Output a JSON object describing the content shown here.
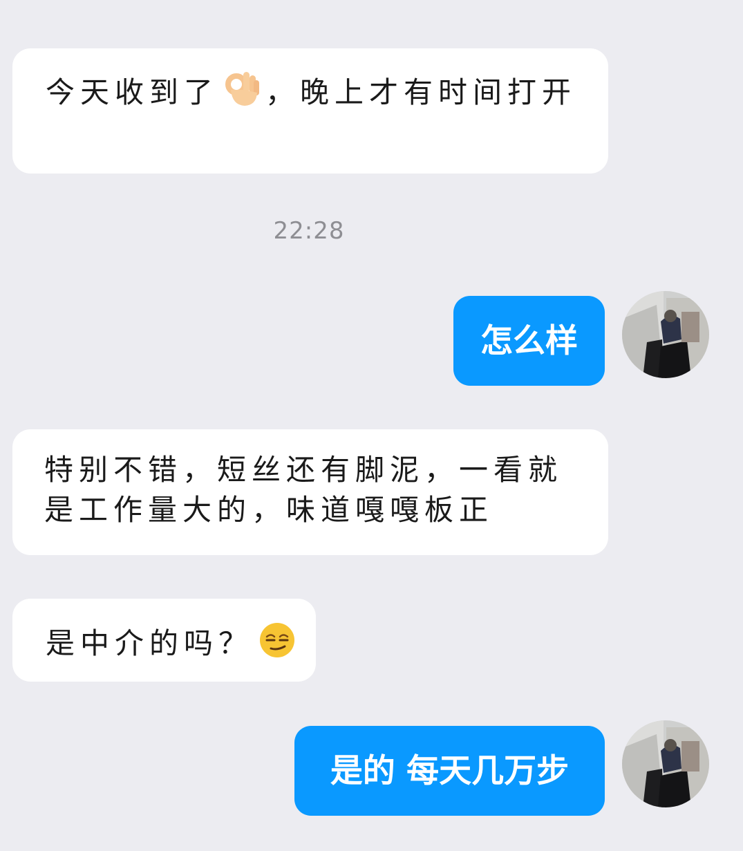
{
  "messages": [
    {
      "from": "contact",
      "text_before": "今天收到了",
      "emoji": "ok-hand-emoji",
      "text_after": "，晚上才有时间打开"
    },
    {
      "type": "timestamp",
      "text": "22:28"
    },
    {
      "from": "me",
      "text": "怎么样",
      "avatar": "user-avatar"
    },
    {
      "from": "contact",
      "text": "特别不错，短丝还有脚泥，一看就是工作量大的，味道嘎嘎板正"
    },
    {
      "from": "contact",
      "text": "是中介的吗？",
      "emoji": "smirk-emoji"
    },
    {
      "from": "me",
      "text": "是的 每天几万步",
      "avatar": "user-avatar"
    }
  ],
  "colors": {
    "background": "#ececf1",
    "incoming_bubble": "#ffffff",
    "outgoing_bubble": "#0a99ff",
    "timestamp": "#8e8e93"
  }
}
